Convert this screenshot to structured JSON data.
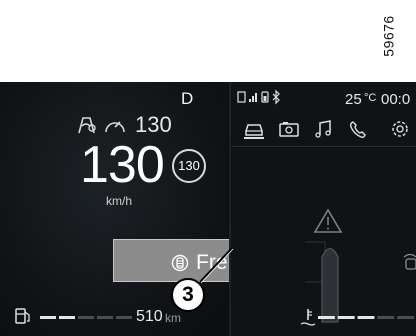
{
  "figure_id": "59676",
  "callout": "3",
  "cluster": {
    "gear": "D",
    "speed_limit": "130",
    "speed": "130",
    "speed_sign": "130",
    "speed_unit": "km/h",
    "alert_icon": "brake-pedal-icon",
    "alert_label": "Freinez",
    "range_value": "510",
    "range_unit": "km",
    "fuel_level_percent": 40
  },
  "multimedia": {
    "outside_temp": "25",
    "temp_unit": "°C",
    "clock": "00:0",
    "status_icons": [
      "sim-icon",
      "signal-icon",
      "phone-battery-icon",
      "bluetooth-icon"
    ],
    "menu_icons": [
      "car-icon",
      "camera-icon",
      "music-icon",
      "phone-icon",
      "settings-icon"
    ],
    "warning_icon": "warning-triangle-icon",
    "coolant_level_percent": 55
  },
  "colors": {
    "screen_background": "#0b0d0f",
    "alert_box": "#8c8c8c",
    "text": "#ffffff"
  }
}
